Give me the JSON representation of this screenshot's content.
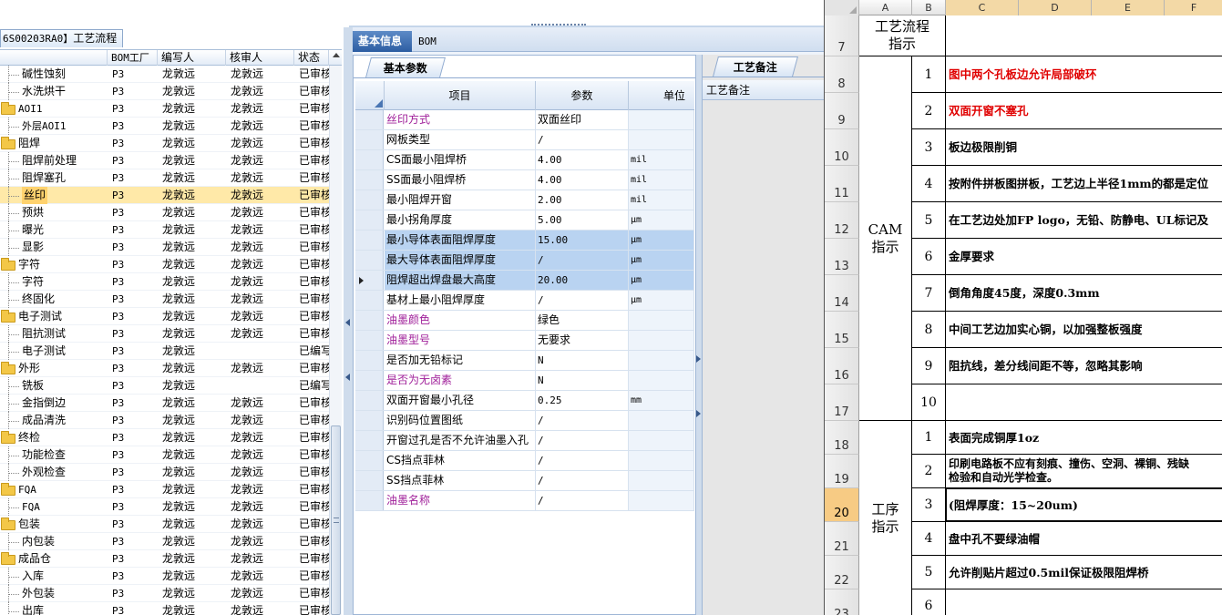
{
  "left_panel": {
    "tab_code": "6S00203RA0】",
    "tab_title": "工艺流程",
    "columns": [
      "BOM工厂",
      "编写人",
      "核审人",
      "状态"
    ],
    "rows": [
      {
        "name": "碱性蚀刻",
        "level": 1,
        "plant": "P3",
        "writer": "龙敦远",
        "reviewer": "龙敦远",
        "status": "已审核"
      },
      {
        "name": "水洗烘干",
        "level": 1,
        "plant": "P3",
        "writer": "龙敦远",
        "reviewer": "龙敦远",
        "status": "已审核"
      },
      {
        "name": "AOI1",
        "level": 0,
        "plant": "P3",
        "writer": "龙敦远",
        "reviewer": "龙敦远",
        "status": "已审核"
      },
      {
        "name": "外层AOI1",
        "level": 1,
        "plant": "P3",
        "writer": "龙敦远",
        "reviewer": "龙敦远",
        "status": "已审核"
      },
      {
        "name": "阻焊",
        "level": 0,
        "plant": "P3",
        "writer": "龙敦远",
        "reviewer": "龙敦远",
        "status": "已审核"
      },
      {
        "name": "阻焊前处理",
        "level": 1,
        "plant": "P3",
        "writer": "龙敦远",
        "reviewer": "龙敦远",
        "status": "已审核"
      },
      {
        "name": "阻焊塞孔",
        "level": 1,
        "plant": "P3",
        "writer": "龙敦远",
        "reviewer": "龙敦远",
        "status": "已审核"
      },
      {
        "name": "丝印",
        "level": 1,
        "plant": "P3",
        "writer": "龙敦远",
        "reviewer": "龙敦远",
        "status": "已审核",
        "selected": true
      },
      {
        "name": "预烘",
        "level": 1,
        "plant": "P3",
        "writer": "龙敦远",
        "reviewer": "龙敦远",
        "status": "已审核"
      },
      {
        "name": "曝光",
        "level": 1,
        "plant": "P3",
        "writer": "龙敦远",
        "reviewer": "龙敦远",
        "status": "已审核"
      },
      {
        "name": "显影",
        "level": 1,
        "plant": "P3",
        "writer": "龙敦远",
        "reviewer": "龙敦远",
        "status": "已审核"
      },
      {
        "name": "字符",
        "level": 0,
        "plant": "P3",
        "writer": "龙敦远",
        "reviewer": "龙敦远",
        "status": "已审核"
      },
      {
        "name": "字符",
        "level": 1,
        "plant": "P3",
        "writer": "龙敦远",
        "reviewer": "龙敦远",
        "status": "已审核"
      },
      {
        "name": "终固化",
        "level": 1,
        "plant": "P3",
        "writer": "龙敦远",
        "reviewer": "龙敦远",
        "status": "已审核"
      },
      {
        "name": "电子测试",
        "level": 0,
        "plant": "P3",
        "writer": "龙敦远",
        "reviewer": "龙敦远",
        "status": "已审核"
      },
      {
        "name": "阻抗测试",
        "level": 1,
        "plant": "P3",
        "writer": "龙敦远",
        "reviewer": "龙敦远",
        "status": "已审核"
      },
      {
        "name": "电子测试",
        "level": 1,
        "plant": "P3",
        "writer": "龙敦远",
        "reviewer": "",
        "status": "已编写"
      },
      {
        "name": "外形",
        "level": 0,
        "plant": "P3",
        "writer": "龙敦远",
        "reviewer": "龙敦远",
        "status": "已审核"
      },
      {
        "name": "铣板",
        "level": 1,
        "plant": "P3",
        "writer": "龙敦远",
        "reviewer": "",
        "status": "已编写"
      },
      {
        "name": "金指倒边",
        "level": 1,
        "plant": "P3",
        "writer": "龙敦远",
        "reviewer": "龙敦远",
        "status": "已审核"
      },
      {
        "name": "成品清洗",
        "level": 1,
        "plant": "P3",
        "writer": "龙敦远",
        "reviewer": "龙敦远",
        "status": "已审核"
      },
      {
        "name": "终检",
        "level": 0,
        "plant": "P3",
        "writer": "龙敦远",
        "reviewer": "龙敦远",
        "status": "已审核"
      },
      {
        "name": "功能检查",
        "level": 1,
        "plant": "P3",
        "writer": "龙敦远",
        "reviewer": "龙敦远",
        "status": "已审核"
      },
      {
        "name": "外观检查",
        "level": 1,
        "plant": "P3",
        "writer": "龙敦远",
        "reviewer": "龙敦远",
        "status": "已审核"
      },
      {
        "name": "FQA",
        "level": 0,
        "plant": "P3",
        "writer": "龙敦远",
        "reviewer": "龙敦远",
        "status": "已审核"
      },
      {
        "name": "FQA",
        "level": 1,
        "plant": "P3",
        "writer": "龙敦远",
        "reviewer": "龙敦远",
        "status": "已审核"
      },
      {
        "name": "包装",
        "level": 0,
        "plant": "P3",
        "writer": "龙敦远",
        "reviewer": "龙敦远",
        "status": "已审核"
      },
      {
        "name": "内包装",
        "level": 1,
        "plant": "P3",
        "writer": "龙敦远",
        "reviewer": "龙敦远",
        "status": "已审核"
      },
      {
        "name": "成品仓",
        "level": 0,
        "plant": "P3",
        "writer": "龙敦远",
        "reviewer": "龙敦远",
        "status": "已审核"
      },
      {
        "name": "入库",
        "level": 1,
        "plant": "P3",
        "writer": "龙敦远",
        "reviewer": "龙敦远",
        "status": "已审核"
      },
      {
        "name": "外包装",
        "level": 1,
        "plant": "P3",
        "writer": "龙敦远",
        "reviewer": "龙敦远",
        "status": "已审核"
      },
      {
        "name": "出库",
        "level": 1,
        "plant": "P3",
        "writer": "龙敦远",
        "reviewer": "龙敦远",
        "status": "已审核"
      }
    ]
  },
  "main_tabs": [
    {
      "label": "基本信息",
      "active": true
    },
    {
      "label": "BOM",
      "active": false
    }
  ],
  "params": {
    "tab_label": "基本参数",
    "columns": [
      "项目",
      "参数",
      "单位"
    ],
    "rows": [
      {
        "item": "丝印方式",
        "value": "双面丝印",
        "unit": "",
        "purple": true
      },
      {
        "item": "网板类型",
        "value": "/",
        "unit": ""
      },
      {
        "item": "CS面最小阻焊桥",
        "value": "4.00",
        "unit": "mil",
        "mono_item": true
      },
      {
        "item": "SS面最小阻焊桥",
        "value": "4.00",
        "unit": "mil",
        "mono_item": true
      },
      {
        "item": "最小阻焊开窗",
        "value": "2.00",
        "unit": "mil"
      },
      {
        "item": "最小拐角厚度",
        "value": "5.00",
        "unit": "μm"
      },
      {
        "item": "最小导体表面阻焊厚度",
        "value": "15.00",
        "unit": "μm",
        "highlight": true
      },
      {
        "item": "最大导体表面阻焊厚度",
        "value": "/",
        "unit": "μm",
        "highlight": true
      },
      {
        "item": "阻焊超出焊盘最大高度",
        "value": "20.00",
        "unit": "μm",
        "highlight": true,
        "current": true
      },
      {
        "item": "基材上最小阻焊厚度",
        "value": "/",
        "unit": "μm"
      },
      {
        "item": "油墨颜色",
        "value": "绿色",
        "unit": "",
        "purple": true
      },
      {
        "item": "油墨型号",
        "value": "无要求",
        "unit": "",
        "purple": true
      },
      {
        "item": "是否加无铅标记",
        "value": "N",
        "unit": ""
      },
      {
        "item": "是否为无卤素",
        "value": "N",
        "unit": "",
        "purple": true
      },
      {
        "item": "双面开窗最小孔径",
        "value": "0.25",
        "unit": "mm"
      },
      {
        "item": "识别码位置图纸",
        "value": "/",
        "unit": ""
      },
      {
        "item": "开窗过孔是否不允许油墨入孔",
        "value": "/",
        "unit": ""
      },
      {
        "item": "CS挡点菲林",
        "value": "/",
        "unit": "",
        "mono_item": true
      },
      {
        "item": "SS挡点菲林",
        "value": "/",
        "unit": "",
        "mono_item": true
      },
      {
        "item": "油墨名称",
        "value": "/",
        "unit": "",
        "purple": true
      }
    ]
  },
  "notes": {
    "tab_label": "工艺备注",
    "column": "工艺备注"
  },
  "sheet": {
    "columns": [
      "A",
      "B",
      "C",
      "D",
      "E",
      "F"
    ],
    "header_title": "工艺流程\n指示",
    "cam_label": "CAM\n指示",
    "process_label": "工序\n指示",
    "row_numbers": [
      "7",
      "8",
      "9",
      "10",
      "11",
      "12",
      "13",
      "14",
      "15",
      "16",
      "17",
      "18",
      "19",
      "20",
      "21",
      "22",
      "23"
    ],
    "active_row": "20",
    "cam_items": [
      {
        "no": "1",
        "text": "图中两个孔板边允许局部破环",
        "red": true
      },
      {
        "no": "2",
        "text": "双面开窗不塞孔",
        "red": true
      },
      {
        "no": "3",
        "text": "板边极限削铜"
      },
      {
        "no": "4",
        "text": "按附件拼板图拼板，工艺边上半径1mm的都是定位"
      },
      {
        "no": "5",
        "text": "在工艺边处加FP logo，无铅、防静电、UL标记及"
      },
      {
        "no": "6",
        "text": "金厚要求"
      },
      {
        "no": "7",
        "text": "倒角角度45度，深度0.3mm"
      },
      {
        "no": "8",
        "text": "中间工艺边加实心铜，以加强整板强度"
      },
      {
        "no": "9",
        "text": "阻抗线，差分线间距不等，忽略其影响"
      },
      {
        "no": "10",
        "text": ""
      }
    ],
    "process_items": [
      {
        "no": "1",
        "text": "表面完成铜厚1oz"
      },
      {
        "no": "2",
        "text": "印刷电路板不应有刻痕、撞伤、空洞、裸铜、残缺\n检验和自动光学检查。"
      },
      {
        "no": "3",
        "text": "(阻焊厚度：15~20um)"
      },
      {
        "no": "4",
        "text": "盘中孔不要绿油帽"
      },
      {
        "no": "5",
        "text": "允许削贴片超过0.5mil保证极限阻焊桥"
      },
      {
        "no": "6",
        "text": ""
      }
    ]
  }
}
